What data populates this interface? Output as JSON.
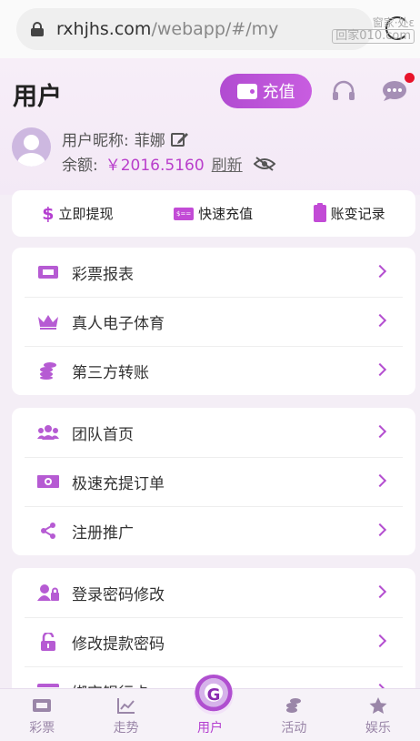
{
  "browser": {
    "url_host": "rxhjhs.com",
    "url_path": "/webapp/#/my",
    "watermark_line1": "窗家·处ɛ",
    "watermark_line2": "回家010.com"
  },
  "header": {
    "title": "用户",
    "recharge_label": "充值"
  },
  "profile": {
    "nickname_label": "用户昵称:",
    "nickname": "菲娜",
    "balance_label": "余额:",
    "balance_value": "￥2016.5160",
    "refresh_label": "刷新"
  },
  "quick_actions": [
    {
      "label": "立即提现",
      "icon": "dollar-icon"
    },
    {
      "label": "快速充值",
      "icon": "card-icon"
    },
    {
      "label": "账变记录",
      "icon": "clipboard-icon"
    }
  ],
  "menu_groups": [
    [
      {
        "label": "彩票报表",
        "icon": "ticket-icon"
      },
      {
        "label": "真人电子体育",
        "icon": "crown-icon"
      },
      {
        "label": "第三方转账",
        "icon": "coins-icon"
      }
    ],
    [
      {
        "label": "团队首页",
        "icon": "team-icon"
      },
      {
        "label": "极速充提订单",
        "icon": "cash-icon"
      },
      {
        "label": "注册推广",
        "icon": "share-icon"
      }
    ],
    [
      {
        "label": "登录密码修改",
        "icon": "user-lock-icon"
      },
      {
        "label": "修改提款密码",
        "icon": "unlock-icon"
      },
      {
        "label": "绑定银行卡",
        "icon": "bank-card-icon"
      }
    ]
  ],
  "bottom_nav": [
    {
      "label": "彩票",
      "icon": "ticket-icon",
      "active": false
    },
    {
      "label": "走势",
      "icon": "trend-icon",
      "active": false
    },
    {
      "label": "用户",
      "icon": "logo-icon",
      "active": true
    },
    {
      "label": "活动",
      "icon": "coins-icon",
      "active": false
    },
    {
      "label": "娱乐",
      "icon": "star-icon",
      "active": false
    }
  ],
  "colors": {
    "accent": "#b43fd0",
    "notif": "#e8142b",
    "background": "#f4eef6"
  }
}
